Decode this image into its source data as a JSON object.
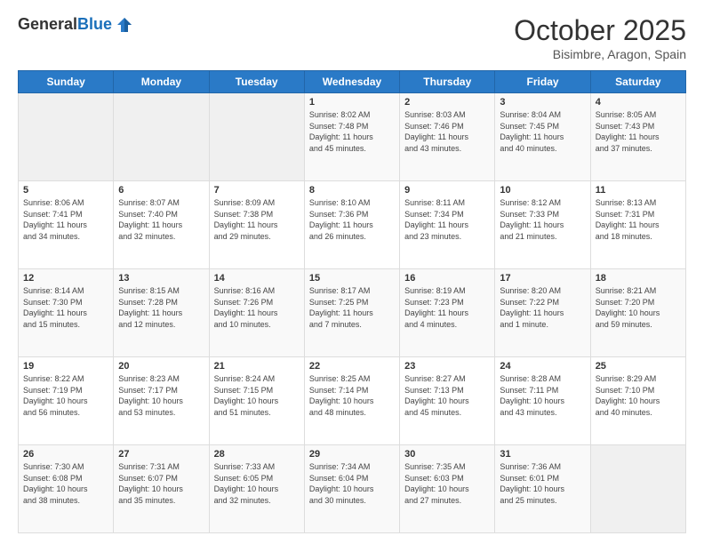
{
  "header": {
    "logo_general": "General",
    "logo_blue": "Blue",
    "month": "October 2025",
    "location": "Bisimbre, Aragon, Spain"
  },
  "days_of_week": [
    "Sunday",
    "Monday",
    "Tuesday",
    "Wednesday",
    "Thursday",
    "Friday",
    "Saturday"
  ],
  "weeks": [
    [
      {
        "day": "",
        "content": ""
      },
      {
        "day": "",
        "content": ""
      },
      {
        "day": "",
        "content": ""
      },
      {
        "day": "1",
        "content": "Sunrise: 8:02 AM\nSunset: 7:48 PM\nDaylight: 11 hours\nand 45 minutes."
      },
      {
        "day": "2",
        "content": "Sunrise: 8:03 AM\nSunset: 7:46 PM\nDaylight: 11 hours\nand 43 minutes."
      },
      {
        "day": "3",
        "content": "Sunrise: 8:04 AM\nSunset: 7:45 PM\nDaylight: 11 hours\nand 40 minutes."
      },
      {
        "day": "4",
        "content": "Sunrise: 8:05 AM\nSunset: 7:43 PM\nDaylight: 11 hours\nand 37 minutes."
      }
    ],
    [
      {
        "day": "5",
        "content": "Sunrise: 8:06 AM\nSunset: 7:41 PM\nDaylight: 11 hours\nand 34 minutes."
      },
      {
        "day": "6",
        "content": "Sunrise: 8:07 AM\nSunset: 7:40 PM\nDaylight: 11 hours\nand 32 minutes."
      },
      {
        "day": "7",
        "content": "Sunrise: 8:09 AM\nSunset: 7:38 PM\nDaylight: 11 hours\nand 29 minutes."
      },
      {
        "day": "8",
        "content": "Sunrise: 8:10 AM\nSunset: 7:36 PM\nDaylight: 11 hours\nand 26 minutes."
      },
      {
        "day": "9",
        "content": "Sunrise: 8:11 AM\nSunset: 7:34 PM\nDaylight: 11 hours\nand 23 minutes."
      },
      {
        "day": "10",
        "content": "Sunrise: 8:12 AM\nSunset: 7:33 PM\nDaylight: 11 hours\nand 21 minutes."
      },
      {
        "day": "11",
        "content": "Sunrise: 8:13 AM\nSunset: 7:31 PM\nDaylight: 11 hours\nand 18 minutes."
      }
    ],
    [
      {
        "day": "12",
        "content": "Sunrise: 8:14 AM\nSunset: 7:30 PM\nDaylight: 11 hours\nand 15 minutes."
      },
      {
        "day": "13",
        "content": "Sunrise: 8:15 AM\nSunset: 7:28 PM\nDaylight: 11 hours\nand 12 minutes."
      },
      {
        "day": "14",
        "content": "Sunrise: 8:16 AM\nSunset: 7:26 PM\nDaylight: 11 hours\nand 10 minutes."
      },
      {
        "day": "15",
        "content": "Sunrise: 8:17 AM\nSunset: 7:25 PM\nDaylight: 11 hours\nand 7 minutes."
      },
      {
        "day": "16",
        "content": "Sunrise: 8:19 AM\nSunset: 7:23 PM\nDaylight: 11 hours\nand 4 minutes."
      },
      {
        "day": "17",
        "content": "Sunrise: 8:20 AM\nSunset: 7:22 PM\nDaylight: 11 hours\nand 1 minute."
      },
      {
        "day": "18",
        "content": "Sunrise: 8:21 AM\nSunset: 7:20 PM\nDaylight: 10 hours\nand 59 minutes."
      }
    ],
    [
      {
        "day": "19",
        "content": "Sunrise: 8:22 AM\nSunset: 7:19 PM\nDaylight: 10 hours\nand 56 minutes."
      },
      {
        "day": "20",
        "content": "Sunrise: 8:23 AM\nSunset: 7:17 PM\nDaylight: 10 hours\nand 53 minutes."
      },
      {
        "day": "21",
        "content": "Sunrise: 8:24 AM\nSunset: 7:15 PM\nDaylight: 10 hours\nand 51 minutes."
      },
      {
        "day": "22",
        "content": "Sunrise: 8:25 AM\nSunset: 7:14 PM\nDaylight: 10 hours\nand 48 minutes."
      },
      {
        "day": "23",
        "content": "Sunrise: 8:27 AM\nSunset: 7:13 PM\nDaylight: 10 hours\nand 45 minutes."
      },
      {
        "day": "24",
        "content": "Sunrise: 8:28 AM\nSunset: 7:11 PM\nDaylight: 10 hours\nand 43 minutes."
      },
      {
        "day": "25",
        "content": "Sunrise: 8:29 AM\nSunset: 7:10 PM\nDaylight: 10 hours\nand 40 minutes."
      }
    ],
    [
      {
        "day": "26",
        "content": "Sunrise: 7:30 AM\nSunset: 6:08 PM\nDaylight: 10 hours\nand 38 minutes."
      },
      {
        "day": "27",
        "content": "Sunrise: 7:31 AM\nSunset: 6:07 PM\nDaylight: 10 hours\nand 35 minutes."
      },
      {
        "day": "28",
        "content": "Sunrise: 7:33 AM\nSunset: 6:05 PM\nDaylight: 10 hours\nand 32 minutes."
      },
      {
        "day": "29",
        "content": "Sunrise: 7:34 AM\nSunset: 6:04 PM\nDaylight: 10 hours\nand 30 minutes."
      },
      {
        "day": "30",
        "content": "Sunrise: 7:35 AM\nSunset: 6:03 PM\nDaylight: 10 hours\nand 27 minutes."
      },
      {
        "day": "31",
        "content": "Sunrise: 7:36 AM\nSunset: 6:01 PM\nDaylight: 10 hours\nand 25 minutes."
      },
      {
        "day": "",
        "content": ""
      }
    ]
  ]
}
